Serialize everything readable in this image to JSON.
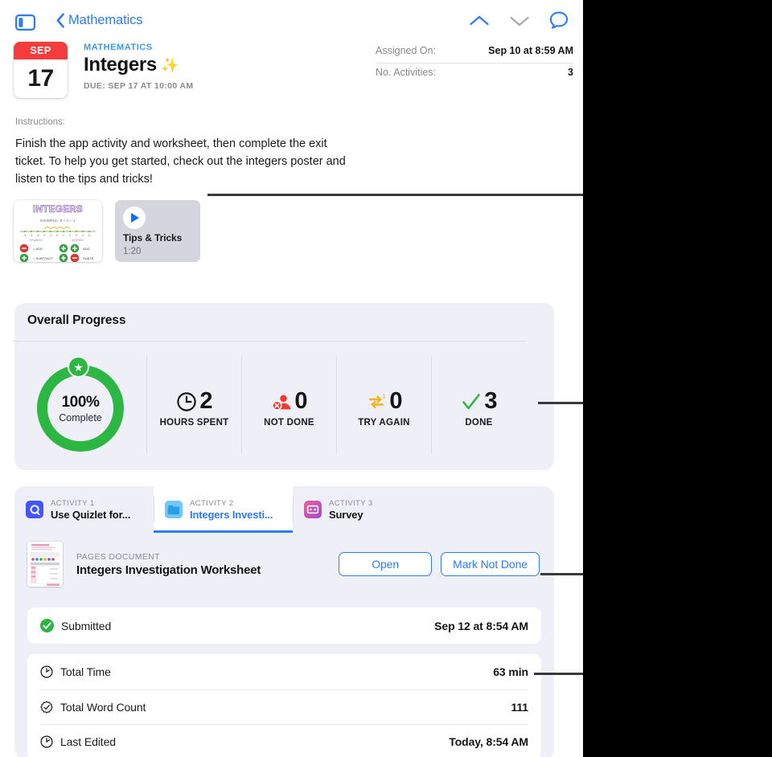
{
  "navbar": {
    "sidebar_toggle_name": "sidebar-toggle-icon",
    "back_label": "Mathematics",
    "icons": [
      "chevron-up-icon",
      "chevron-down-icon",
      "comment-bubble-icon"
    ],
    "accent_color": "#2b7bf6",
    "disabled_color": "#a8a8ae"
  },
  "assignment": {
    "calendar": {
      "month": "SEP",
      "day": "17",
      "month_bg": "#f43c3c"
    },
    "course": "MATHEMATICS",
    "title": "Integers",
    "sparkle": "✨",
    "due": "DUE: SEP 17 AT 10:00 AM"
  },
  "meta": {
    "rows": [
      {
        "key": "Assigned On:",
        "value": "Sep 10 at 8:59 AM"
      },
      {
        "key": "No. Activities:",
        "value": "3"
      }
    ]
  },
  "instructions": {
    "label": "Instructions:",
    "text": "Finish the app activity and worksheet, then complete the exit ticket. To help you get started, check out the integers poster and listen to the tips and tricks!"
  },
  "attachments": {
    "poster": {
      "name": "integers-poster-thumbnail",
      "heading": "INTEGERS",
      "example": "EXAMPLE: -5 + 4 = -1",
      "left_label": "negative",
      "right_label": "positive"
    },
    "video": {
      "title": "Tips & Tricks",
      "duration": "1:20",
      "play_icon": "play-icon"
    }
  },
  "progress": {
    "title": "Overall Progress",
    "ring": {
      "percent": "100%",
      "sub": "Complete",
      "color": "#2cb742",
      "badge_icon": "star-icon",
      "badge_glyph": "★"
    },
    "stats": [
      {
        "number": "2",
        "caption": "HOURS SPENT",
        "icon": "clock-icon",
        "icon_color": "#141414"
      },
      {
        "number": "0",
        "caption": "NOT DONE",
        "icon": "not-done-icon",
        "icon_color": "#ef3b2f"
      },
      {
        "number": "0",
        "caption": "TRY AGAIN",
        "icon": "try-again-icon",
        "icon_color": "#f5b41d"
      },
      {
        "number": "3",
        "caption": "DONE",
        "icon": "checkmark-icon",
        "icon_color": "#2cb742"
      }
    ]
  },
  "activities": {
    "tabs": [
      {
        "kicker": "ACTIVITY 1",
        "name": "Use Quizlet for...",
        "icon": "quizlet-app-icon",
        "active": false
      },
      {
        "kicker": "ACTIVITY 2",
        "name": "Integers Investi...",
        "icon": "pages-folder-icon",
        "active": true
      },
      {
        "kicker": "ACTIVITY 3",
        "name": "Survey",
        "icon": "survey-app-icon",
        "active": false
      }
    ],
    "document": {
      "kicker": "PAGES DOCUMENT",
      "name": "Integers Investigation Worksheet",
      "thumb_name": "pages-document-thumbnail",
      "open_label": "Open",
      "mark_label": "Mark Not Done"
    },
    "submitted": {
      "icon": "check-circle-icon",
      "label": "Submitted",
      "value": "Sep 12 at 8:54 AM",
      "icon_color": "#2cb742"
    },
    "details": [
      {
        "icon": "clock-icon",
        "label": "Total Time",
        "value": "63 min"
      },
      {
        "icon": "word-count-icon",
        "label": "Total Word Count",
        "value": "111"
      },
      {
        "icon": "clock-icon",
        "label": "Last Edited",
        "value": "Today, 8:54 AM"
      }
    ]
  },
  "callouts": [
    {
      "name": "callout-line-attachments"
    },
    {
      "name": "callout-line-progress"
    },
    {
      "name": "callout-line-mark-not-done"
    },
    {
      "name": "callout-line-total-time"
    }
  ]
}
